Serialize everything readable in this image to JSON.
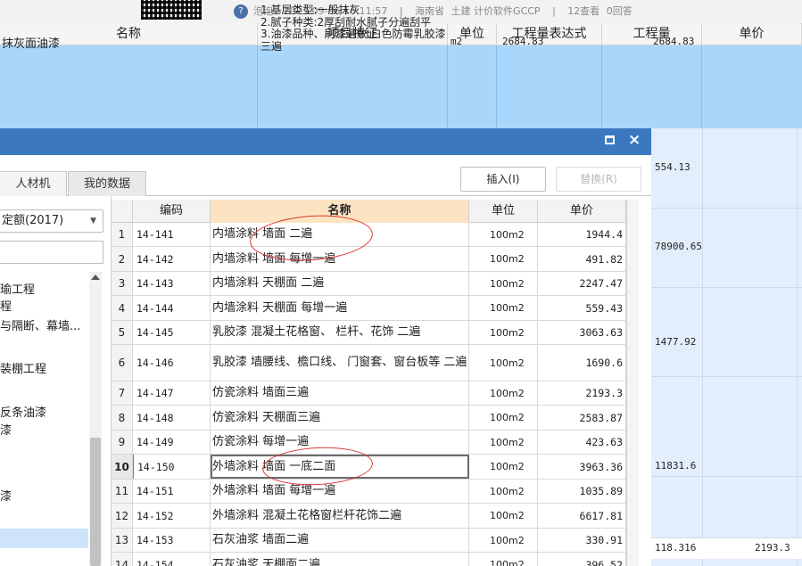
{
  "topbar": {
    "avatar_glyph": "?",
    "user": "泡泡",
    "datetime": "2023-09-06 16:11:57",
    "sep": "|",
    "location": "海南省",
    "category": "土建 计价软件GCCP",
    "views": "12查看",
    "replies": "0回答"
  },
  "background_table": {
    "columns": [
      "名称",
      "项目特征",
      "单位",
      "工程量表达式",
      "工程量",
      "单价"
    ],
    "row1": {
      "name": "抹灰面油漆",
      "features": "1.基层类型:一般抹灰\n2.腻子种类:2厚刮耐水腻子分遍刮平\n3.油漆品种、刷漆遍数:白色防霉乳胶漆三遍",
      "unit": "m2",
      "expression": "2684.83",
      "quantity": "2684.83"
    },
    "right_quantities": [
      "554.13",
      "78900.65",
      "1477.92",
      "11831.6",
      "118.316"
    ],
    "bottom_price": "2193.3"
  },
  "dialog": {
    "close_glyph": "×",
    "tabs": [
      "人材机",
      "我的数据"
    ],
    "insert_label": "插入(I)",
    "replace_label": "替换(R)",
    "quota_select": "定额(2017)",
    "tree_items": [
      "瑜工程",
      "程",
      "与隔断、幕墙...",
      "装棚工程",
      "反条油漆",
      "漆",
      "漆"
    ],
    "table_headers": {
      "code": "编码",
      "name": "名称",
      "unit": "单位",
      "price": "单价"
    },
    "rows": [
      {
        "idx": "1",
        "code": "14-141",
        "name": "内墙涂料 墙面 二遍",
        "unit": "100m2",
        "price": "1944.4"
      },
      {
        "idx": "2",
        "code": "14-142",
        "name": "内墙涂料 墙面 每增一遍",
        "unit": "100m2",
        "price": "491.82"
      },
      {
        "idx": "3",
        "code": "14-143",
        "name": "内墙涂料 天棚面 二遍",
        "unit": "100m2",
        "price": "2247.47"
      },
      {
        "idx": "4",
        "code": "14-144",
        "name": "内墙涂料 天棚面 每增一遍",
        "unit": "100m2",
        "price": "559.43"
      },
      {
        "idx": "5",
        "code": "14-145",
        "name": "乳胶漆 混凝土花格窗、 栏杆、花饰 二遍",
        "unit": "100m2",
        "price": "3063.63"
      },
      {
        "idx": "6",
        "code": "14-146",
        "name": "乳胶漆 墙腰线、檐口线、 门窗套、窗台板等 二遍",
        "unit": "100m2",
        "price": "1690.6"
      },
      {
        "idx": "7",
        "code": "14-147",
        "name": "仿瓷涂料 墙面三遍",
        "unit": "100m2",
        "price": "2193.3"
      },
      {
        "idx": "8",
        "code": "14-148",
        "name": "仿瓷涂料 天棚面三遍",
        "unit": "100m2",
        "price": "2583.87"
      },
      {
        "idx": "9",
        "code": "14-149",
        "name": "仿瓷涂料 每增一遍",
        "unit": "100m2",
        "price": "423.63"
      },
      {
        "idx": "10",
        "code": "14-150",
        "name": "外墙涂料 墙面 一底二面",
        "unit": "100m2",
        "price": "3963.36"
      },
      {
        "idx": "11",
        "code": "14-151",
        "name": "外墙涂料 墙面 每增一遍",
        "unit": "100m2",
        "price": "1035.89"
      },
      {
        "idx": "12",
        "code": "14-152",
        "name": "外墙涂料 混凝土花格窗栏杆花饰二遍",
        "unit": "100m2",
        "price": "6617.81"
      },
      {
        "idx": "13",
        "code": "14-153",
        "name": "石灰油浆 墙面二遍",
        "unit": "100m2",
        "price": "330.91"
      },
      {
        "idx": "14",
        "code": "14-154",
        "name": "石灰油浆 天棚面二遍",
        "unit": "100m2",
        "price": "396.52"
      }
    ]
  },
  "colors": {
    "title_bar": "#3b78c0",
    "selected_row_bg": "#a9d6fb",
    "name_header_bg": "#fce4c2",
    "annotation_red": "#d8362f"
  }
}
